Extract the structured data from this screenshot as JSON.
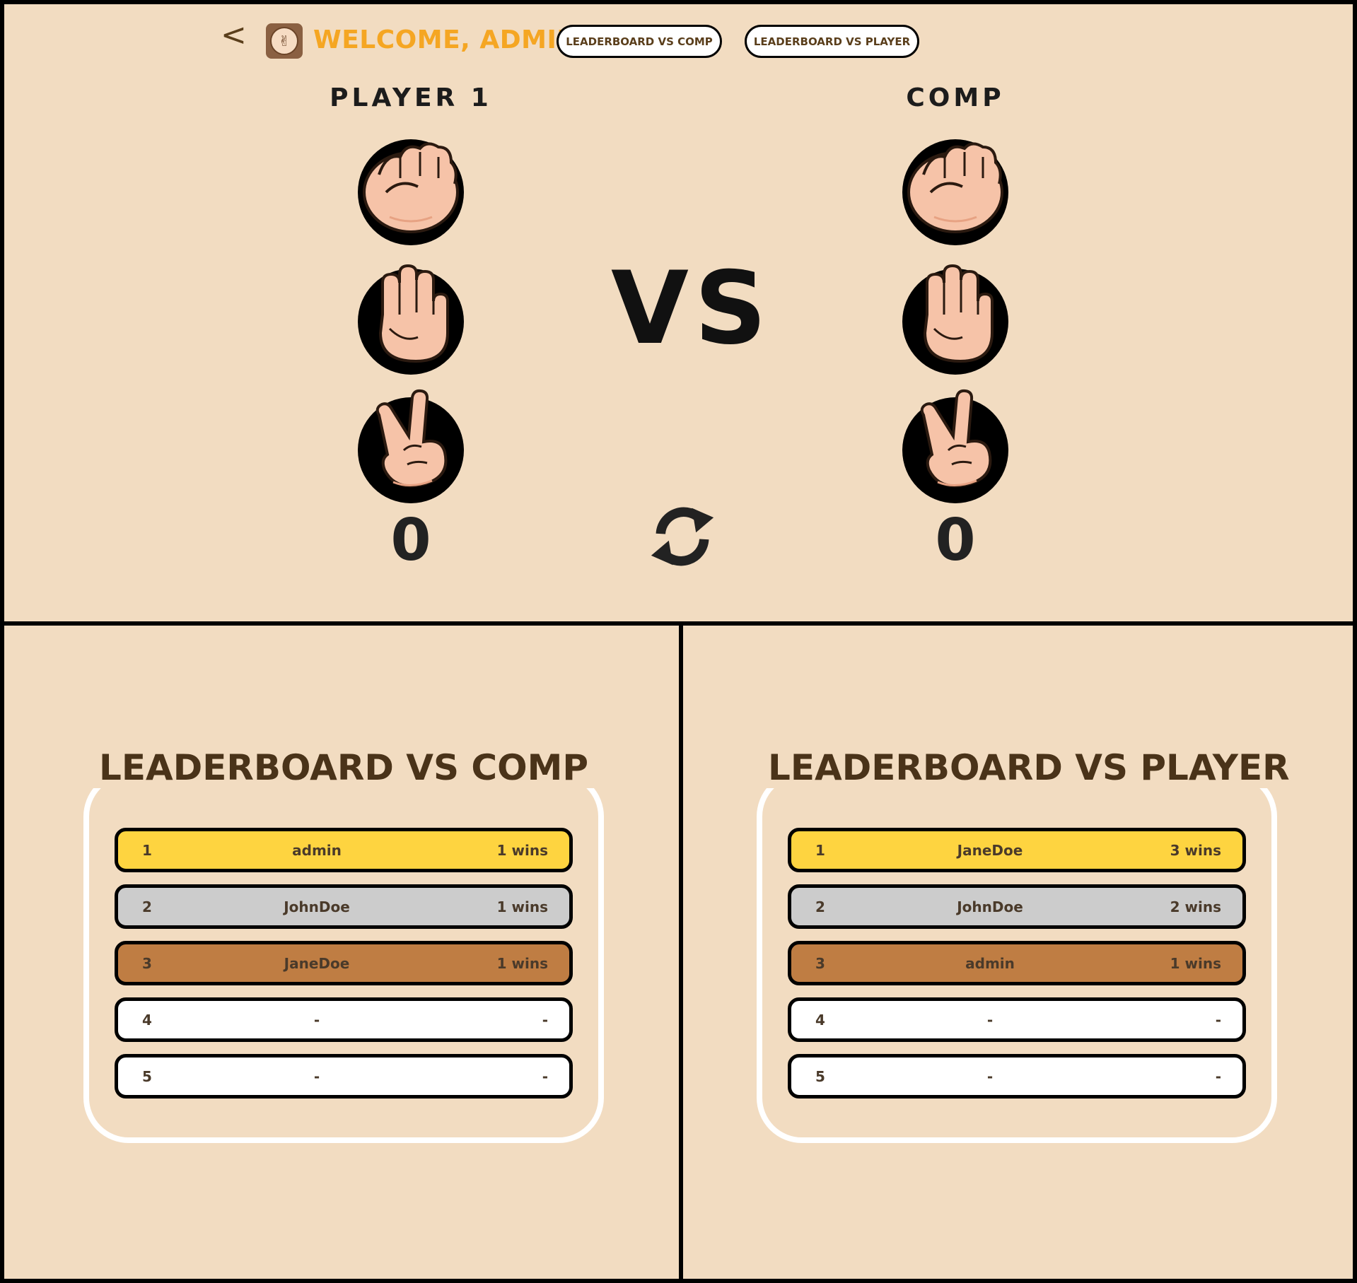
{
  "header": {
    "back_label": "<",
    "welcome": "WELCOME, ADMIN",
    "nav_comp": "LEADERBOARD VS COMP",
    "nav_player": "LEADERBOARD VS PLAYER"
  },
  "game": {
    "player1": {
      "label": "PLAYER 1",
      "score": "0"
    },
    "player2": {
      "label": "COMP",
      "score": "0"
    },
    "vs": "VS",
    "choices": [
      "rock",
      "paper",
      "scissors"
    ]
  },
  "leaderboard_comp": {
    "title": "LEADERBOARD VS COMP",
    "rows": [
      {
        "rank": "1",
        "name": "admin",
        "wins": "1 wins"
      },
      {
        "rank": "2",
        "name": "JohnDoe",
        "wins": "1 wins"
      },
      {
        "rank": "3",
        "name": "JaneDoe",
        "wins": "1 wins"
      },
      {
        "rank": "4",
        "name": "-",
        "wins": "-"
      },
      {
        "rank": "5",
        "name": "-",
        "wins": "-"
      }
    ]
  },
  "leaderboard_player": {
    "title": "LEADERBOARD VS PLAYER",
    "rows": [
      {
        "rank": "1",
        "name": "JaneDoe",
        "wins": "3 wins"
      },
      {
        "rank": "2",
        "name": "JohnDoe",
        "wins": "2 wins"
      },
      {
        "rank": "3",
        "name": "admin",
        "wins": "1 wins"
      },
      {
        "rank": "4",
        "name": "-",
        "wins": "-"
      },
      {
        "rank": "5",
        "name": "-",
        "wins": "-"
      }
    ]
  },
  "colors": {
    "background": "#f2dcc1",
    "welcome": "#f5a623",
    "gold": "#fed440",
    "silver": "#cccccc",
    "bronze": "#bf7d43"
  }
}
